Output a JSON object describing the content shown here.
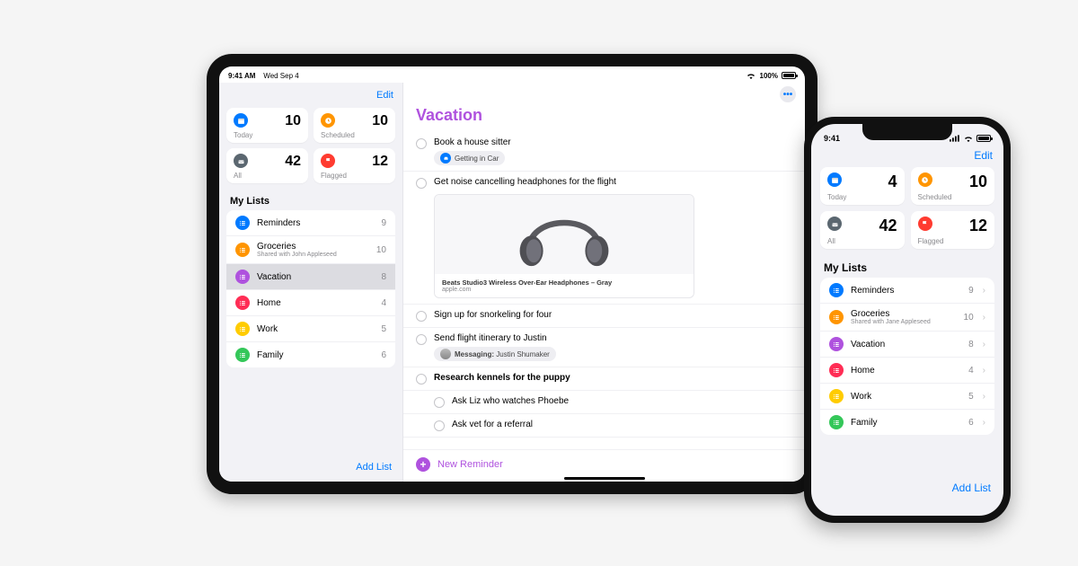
{
  "ipad": {
    "status": {
      "time": "9:41 AM",
      "date": "Wed Sep 4",
      "battery": "100%"
    },
    "edit_label": "Edit",
    "smart": [
      {
        "label": "Today",
        "count": "10",
        "icon": "calendar",
        "bg": "#007aff"
      },
      {
        "label": "Scheduled",
        "count": "10",
        "icon": "clock",
        "bg": "#ff9500"
      },
      {
        "label": "All",
        "count": "42",
        "icon": "tray",
        "bg": "#5b6770"
      },
      {
        "label": "Flagged",
        "count": "12",
        "icon": "flag",
        "bg": "#ff3b30"
      }
    ],
    "section_header": "My Lists",
    "lists": [
      {
        "name": "Reminders",
        "count": "9",
        "color": "#007aff",
        "sub": ""
      },
      {
        "name": "Groceries",
        "count": "10",
        "color": "#ff9500",
        "sub": "Shared with John Appleseed"
      },
      {
        "name": "Vacation",
        "count": "8",
        "color": "#af52de",
        "sub": "",
        "selected": true
      },
      {
        "name": "Home",
        "count": "4",
        "color": "#ff2d55",
        "sub": ""
      },
      {
        "name": "Work",
        "count": "5",
        "color": "#ffcc00",
        "sub": ""
      },
      {
        "name": "Family",
        "count": "6",
        "color": "#34c759",
        "sub": ""
      }
    ],
    "add_list_label": "Add List",
    "detail": {
      "more_label": "•••",
      "title": "Vacation",
      "items": [
        {
          "text": "Book a house sitter",
          "tag": {
            "icon_bg": "#007aff",
            "label": "Getting in Car"
          }
        },
        {
          "text": "Get noise cancelling headphones for the flight",
          "card": {
            "title": "Beats Studio3 Wireless Over-Ear Headphones – Gray",
            "domain": "apple.com"
          }
        },
        {
          "text": "Sign up for snorkeling for four"
        },
        {
          "text": "Send flight itinerary to Justin",
          "tag": {
            "icon_bg": "#34c759",
            "prefix": "Messaging:",
            "label": " Justin Shumaker",
            "avatar": true
          }
        },
        {
          "text": "Research kennels for the puppy",
          "bold": true,
          "subs": [
            "Ask Liz who watches Phoebe",
            "Ask vet for a referral"
          ]
        }
      ],
      "new_reminder_label": "New Reminder"
    }
  },
  "iphone": {
    "status": {
      "time": "9:41"
    },
    "edit_label": "Edit",
    "smart": [
      {
        "label": "Today",
        "count": "4",
        "icon": "calendar",
        "bg": "#007aff"
      },
      {
        "label": "Scheduled",
        "count": "10",
        "icon": "clock",
        "bg": "#ff9500"
      },
      {
        "label": "All",
        "count": "42",
        "icon": "tray",
        "bg": "#5b6770"
      },
      {
        "label": "Flagged",
        "count": "12",
        "icon": "flag",
        "bg": "#ff3b30"
      }
    ],
    "section_header": "My Lists",
    "lists": [
      {
        "name": "Reminders",
        "count": "9",
        "color": "#007aff",
        "sub": ""
      },
      {
        "name": "Groceries",
        "count": "10",
        "color": "#ff9500",
        "sub": "Shared with Jane Appleseed"
      },
      {
        "name": "Vacation",
        "count": "8",
        "color": "#af52de",
        "sub": ""
      },
      {
        "name": "Home",
        "count": "4",
        "color": "#ff2d55",
        "sub": ""
      },
      {
        "name": "Work",
        "count": "5",
        "color": "#ffcc00",
        "sub": ""
      },
      {
        "name": "Family",
        "count": "6",
        "color": "#34c759",
        "sub": ""
      }
    ],
    "add_list_label": "Add List"
  }
}
